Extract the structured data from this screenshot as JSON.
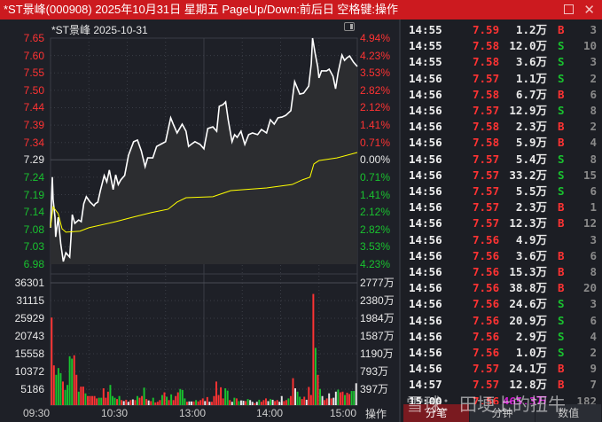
{
  "title": "*ST景峰(000908) 2025年10月31日 星期五 PageUp/Down:前后日 空格键:操作",
  "subtitle": "*ST景峰   2025-10-31",
  "price_axis": {
    "left": [
      "7.65",
      "7.60",
      "7.55",
      "7.50",
      "7.44",
      "7.39",
      "7.34",
      "7.29",
      "7.24",
      "7.19",
      "7.14",
      "7.08",
      "7.03",
      "6.98"
    ],
    "right": [
      "4.94%",
      "4.23%",
      "3.53%",
      "2.82%",
      "2.12%",
      "1.41%",
      "0.71%",
      "0.00%",
      "0.71%",
      "1.41%",
      "2.12%",
      "2.82%",
      "3.53%",
      "4.23%"
    ]
  },
  "volume_axis": {
    "left": [
      "36301",
      "31115",
      "25929",
      "20743",
      "15558",
      "10372",
      "5186"
    ],
    "right": [
      "2777万",
      "2380万",
      "1984万",
      "1587万",
      "1190万",
      "793万",
      "397万"
    ]
  },
  "time_axis": [
    "09:30",
    "10:30",
    "13:00",
    "14:00",
    "15:00"
  ],
  "ops_label": "操作",
  "colors": {
    "up": "#ff3333",
    "down": "#19c22f",
    "flat": "#e8e8e8",
    "avg": "#ffff00",
    "title_bar": "#cc1a1f"
  },
  "chart_data": {
    "type": "line",
    "prev_close": 7.29,
    "ylim": [
      6.98,
      7.65
    ],
    "xlim_minutes": [
      0,
      240
    ],
    "price": [
      [
        0,
        7.088
      ],
      [
        1.4,
        7.238
      ],
      [
        2,
        7.172
      ],
      [
        3.5,
        7.119
      ],
      [
        4,
        7.061
      ],
      [
        6,
        7.119
      ],
      [
        8,
        7.04
      ],
      [
        10,
        6.988
      ],
      [
        12,
        7.014
      ],
      [
        15,
        7.001
      ],
      [
        16,
        7.059
      ],
      [
        17,
        7.127
      ],
      [
        19,
        7.101
      ],
      [
        22,
        7.111
      ],
      [
        24,
        7.106
      ],
      [
        26,
        7.159
      ],
      [
        28,
        7.18
      ],
      [
        31,
        7.164
      ],
      [
        34,
        7.153
      ],
      [
        35,
        7.159
      ],
      [
        37,
        7.164
      ],
      [
        39,
        7.198
      ],
      [
        42,
        7.243
      ],
      [
        44,
        7.224
      ],
      [
        46,
        7.259
      ],
      [
        49,
        7.201
      ],
      [
        51,
        7.245
      ],
      [
        53,
        7.216
      ],
      [
        55,
        7.23
      ],
      [
        58,
        7.243
      ],
      [
        61,
        7.303
      ],
      [
        65,
        7.343
      ],
      [
        68,
        7.348
      ],
      [
        71,
        7.316
      ],
      [
        74,
        7.269
      ],
      [
        76,
        7.295
      ],
      [
        80,
        7.295
      ],
      [
        83,
        7.329
      ],
      [
        87,
        7.337
      ],
      [
        90,
        7.343
      ],
      [
        94,
        7.414
      ],
      [
        96,
        7.395
      ],
      [
        99,
        7.369
      ],
      [
        103,
        7.395
      ],
      [
        106,
        7.374
      ],
      [
        108,
        7.329
      ],
      [
        110,
        7.335
      ],
      [
        113,
        7.343
      ],
      [
        117,
        7.335
      ],
      [
        120,
        7.322
      ],
      [
        123,
        7.382
      ],
      [
        127,
        7.387
      ],
      [
        130,
        7.374
      ],
      [
        132,
        7.448
      ],
      [
        135,
        7.453
      ],
      [
        137,
        7.461
      ],
      [
        139,
        7.408
      ],
      [
        142,
        7.343
      ],
      [
        144,
        7.364
      ],
      [
        146,
        7.356
      ],
      [
        149,
        7.374
      ],
      [
        152,
        7.335
      ],
      [
        155,
        7.364
      ],
      [
        158,
        7.369
      ],
      [
        162,
        7.364
      ],
      [
        165,
        7.379
      ],
      [
        169,
        7.369
      ],
      [
        172,
        7.408
      ],
      [
        175,
        7.395
      ],
      [
        178,
        7.414
      ],
      [
        181,
        7.416
      ],
      [
        184,
        7.421
      ],
      [
        188,
        7.435
      ],
      [
        191,
        7.521
      ],
      [
        195,
        7.484
      ],
      [
        198,
        7.487
      ],
      [
        202,
        7.508
      ],
      [
        204,
        7.574
      ],
      [
        205,
        7.65
      ],
      [
        207,
        7.605
      ],
      [
        209,
        7.566
      ],
      [
        210,
        7.532
      ],
      [
        212,
        7.553
      ],
      [
        216,
        7.553
      ],
      [
        218,
        7.558
      ],
      [
        221,
        7.537
      ],
      [
        223,
        7.5
      ],
      [
        225,
        7.548
      ],
      [
        228,
        7.6
      ],
      [
        230,
        7.584
      ],
      [
        232,
        7.592
      ],
      [
        234,
        7.597
      ],
      [
        237,
        7.579
      ],
      [
        240,
        7.566
      ]
    ],
    "avg": [
      [
        0,
        7.09
      ],
      [
        2,
        7.15
      ],
      [
        6,
        7.13
      ],
      [
        9,
        7.085
      ],
      [
        12,
        7.075
      ],
      [
        23,
        7.078
      ],
      [
        30,
        7.088
      ],
      [
        51,
        7.106
      ],
      [
        65,
        7.12
      ],
      [
        79,
        7.133
      ],
      [
        92,
        7.143
      ],
      [
        99,
        7.164
      ],
      [
        106,
        7.177
      ],
      [
        127,
        7.18
      ],
      [
        141,
        7.198
      ],
      [
        169,
        7.206
      ],
      [
        189,
        7.216
      ],
      [
        197,
        7.23
      ],
      [
        203,
        7.238
      ],
      [
        206,
        7.277
      ],
      [
        210,
        7.287
      ],
      [
        224,
        7.295
      ],
      [
        240,
        7.311
      ]
    ],
    "volume_max": 36301,
    "volume": [
      [
        26000,
        "u"
      ],
      [
        11800,
        "u"
      ],
      [
        9000,
        "d"
      ],
      [
        11000,
        "d"
      ],
      [
        9500,
        "d"
      ],
      [
        7000,
        "u"
      ],
      [
        4500,
        "d"
      ],
      [
        6000,
        "d"
      ],
      [
        14500,
        "d"
      ],
      [
        13800,
        "d"
      ],
      [
        14800,
        "u"
      ],
      [
        9000,
        "u"
      ],
      [
        4000,
        "d"
      ],
      [
        5500,
        "u"
      ],
      [
        5500,
        "u"
      ],
      [
        3500,
        "d"
      ],
      [
        2700,
        "u"
      ],
      [
        2700,
        "u"
      ],
      [
        2700,
        "u"
      ],
      [
        2700,
        "u"
      ],
      [
        2000,
        "u"
      ],
      [
        2200,
        "d"
      ],
      [
        2200,
        "d"
      ],
      [
        5000,
        "u"
      ],
      [
        2200,
        "u"
      ],
      [
        4000,
        "u"
      ],
      [
        6000,
        "d"
      ],
      [
        2700,
        "d"
      ],
      [
        2200,
        "d"
      ],
      [
        1800,
        "u"
      ],
      [
        2700,
        "d"
      ],
      [
        1500,
        "u"
      ],
      [
        1200,
        "f"
      ],
      [
        1600,
        "u"
      ],
      [
        1000,
        "f"
      ],
      [
        1500,
        "u"
      ],
      [
        1700,
        "f"
      ],
      [
        1500,
        "u"
      ],
      [
        2700,
        "d"
      ],
      [
        2200,
        "u"
      ],
      [
        2700,
        "u"
      ],
      [
        5200,
        "d"
      ],
      [
        1800,
        "u"
      ],
      [
        1400,
        "f"
      ],
      [
        1200,
        "u"
      ],
      [
        2200,
        "d"
      ],
      [
        800,
        "u"
      ],
      [
        1000,
        "u"
      ],
      [
        1500,
        "u"
      ],
      [
        3000,
        "d"
      ],
      [
        3800,
        "u"
      ],
      [
        2500,
        "d"
      ],
      [
        1500,
        "u"
      ],
      [
        3200,
        "d"
      ],
      [
        1500,
        "u"
      ],
      [
        2700,
        "u"
      ],
      [
        3800,
        "u"
      ],
      [
        4800,
        "d"
      ],
      [
        4500,
        "d"
      ],
      [
        2000,
        "d"
      ],
      [
        1000,
        "u"
      ],
      [
        1100,
        "f"
      ],
      [
        1100,
        "f"
      ],
      [
        1100,
        "u"
      ],
      [
        1500,
        "d"
      ],
      [
        1100,
        "u"
      ],
      [
        1500,
        "u"
      ],
      [
        2000,
        "u"
      ],
      [
        1200,
        "f"
      ],
      [
        2400,
        "u"
      ],
      [
        1000,
        "f"
      ],
      [
        1000,
        "u"
      ],
      [
        2700,
        "u"
      ],
      [
        7000,
        "u"
      ],
      [
        3000,
        "u"
      ],
      [
        5300,
        "u"
      ],
      [
        2000,
        "u"
      ],
      [
        5000,
        "d"
      ],
      [
        4300,
        "d"
      ],
      [
        1500,
        "u"
      ],
      [
        1000,
        "f"
      ],
      [
        2200,
        "d"
      ],
      [
        2000,
        "u"
      ],
      [
        1200,
        "d"
      ],
      [
        1400,
        "f"
      ],
      [
        1300,
        "f"
      ],
      [
        1200,
        "u"
      ],
      [
        1800,
        "d"
      ],
      [
        1500,
        "f"
      ],
      [
        1000,
        "f"
      ],
      [
        600,
        "u"
      ],
      [
        1000,
        "f"
      ],
      [
        1600,
        "d"
      ],
      [
        1000,
        "u"
      ],
      [
        1500,
        "u"
      ],
      [
        2000,
        "u"
      ],
      [
        1200,
        "f"
      ],
      [
        1800,
        "d"
      ],
      [
        1600,
        "f"
      ],
      [
        1200,
        "u"
      ],
      [
        1500,
        "u"
      ],
      [
        1000,
        "f"
      ],
      [
        2700,
        "f"
      ],
      [
        1200,
        "u"
      ],
      [
        1500,
        "u"
      ],
      [
        2000,
        "d"
      ],
      [
        2700,
        "u"
      ],
      [
        8000,
        "u"
      ],
      [
        5000,
        "f"
      ],
      [
        4000,
        "d"
      ],
      [
        2500,
        "d"
      ],
      [
        1800,
        "u"
      ],
      [
        2500,
        "u"
      ],
      [
        1600,
        "f"
      ],
      [
        5400,
        "u"
      ],
      [
        3000,
        "u"
      ],
      [
        33000,
        "u"
      ],
      [
        17000,
        "d"
      ],
      [
        9000,
        "u"
      ],
      [
        4800,
        "d"
      ],
      [
        2700,
        "f"
      ],
      [
        1500,
        "u"
      ],
      [
        2000,
        "u"
      ],
      [
        3500,
        "f"
      ],
      [
        2000,
        "u"
      ],
      [
        2200,
        "f"
      ],
      [
        4000,
        "f"
      ],
      [
        4600,
        "d"
      ],
      [
        3800,
        "u"
      ],
      [
        4000,
        "u"
      ],
      [
        3000,
        "d"
      ],
      [
        3700,
        "u"
      ],
      [
        3300,
        "u"
      ],
      [
        4200,
        "d"
      ],
      [
        4200,
        "d"
      ],
      [
        6500,
        "f"
      ]
    ]
  },
  "trades": [
    {
      "time": "14:55",
      "price": "7.59",
      "vol": "1.2万",
      "bs": "B",
      "n": "3"
    },
    {
      "time": "14:55",
      "price": "7.58",
      "vol": "12.0万",
      "bs": "S",
      "n": "10"
    },
    {
      "time": "14:55",
      "price": "7.58",
      "vol": "3.6万",
      "bs": "S",
      "n": "3"
    },
    {
      "time": "14:56",
      "price": "7.57",
      "vol": "1.1万",
      "bs": "S",
      "n": "2"
    },
    {
      "time": "14:56",
      "price": "7.58",
      "vol": "6.7万",
      "bs": "B",
      "n": "6"
    },
    {
      "time": "14:56",
      "price": "7.57",
      "vol": "12.9万",
      "bs": "S",
      "n": "8"
    },
    {
      "time": "14:56",
      "price": "7.58",
      "vol": "2.3万",
      "bs": "B",
      "n": "2"
    },
    {
      "time": "14:56",
      "price": "7.58",
      "vol": "5.9万",
      "bs": "B",
      "n": "4"
    },
    {
      "time": "14:56",
      "price": "7.57",
      "vol": "5.4万",
      "bs": "S",
      "n": "8"
    },
    {
      "time": "14:56",
      "price": "7.57",
      "vol": "33.2万",
      "bs": "S",
      "n": "15"
    },
    {
      "time": "14:56",
      "price": "7.57",
      "vol": "5.5万",
      "bs": "S",
      "n": "6"
    },
    {
      "time": "14:56",
      "price": "7.57",
      "vol": "2.3万",
      "bs": "B",
      "n": "1"
    },
    {
      "time": "14:56",
      "price": "7.57",
      "vol": "12.3万",
      "bs": "B",
      "n": "12"
    },
    {
      "time": "14:56",
      "price": "7.56",
      "vol": "4.9万",
      "bs": "",
      "n": "3"
    },
    {
      "time": "14:56",
      "price": "7.56",
      "vol": "3.6万",
      "bs": "B",
      "n": "6"
    },
    {
      "time": "14:56",
      "price": "7.56",
      "vol": "15.3万",
      "bs": "B",
      "n": "8"
    },
    {
      "time": "14:56",
      "price": "7.56",
      "vol": "38.8万",
      "bs": "B",
      "n": "20"
    },
    {
      "time": "14:56",
      "price": "7.56",
      "vol": "24.6万",
      "bs": "S",
      "n": "3"
    },
    {
      "time": "14:56",
      "price": "7.56",
      "vol": "20.9万",
      "bs": "S",
      "n": "6"
    },
    {
      "time": "14:56",
      "price": "7.56",
      "vol": "2.9万",
      "bs": "S",
      "n": "4"
    },
    {
      "time": "14:56",
      "price": "7.56",
      "vol": "1.0万",
      "bs": "S",
      "n": "2"
    },
    {
      "time": "14:56",
      "price": "7.57",
      "vol": "24.1万",
      "bs": "B",
      "n": "9"
    },
    {
      "time": "14:57",
      "price": "7.57",
      "vol": "12.8万",
      "bs": "B",
      "n": "7"
    },
    {
      "time": "15:00",
      "price": "7.56",
      "vol": "465.3万",
      "bs": "",
      "n": "182"
    }
  ],
  "tabs": [
    "分笔",
    "分钟",
    "数值"
  ],
  "watermark": "雪球：田埂上的扭牛"
}
